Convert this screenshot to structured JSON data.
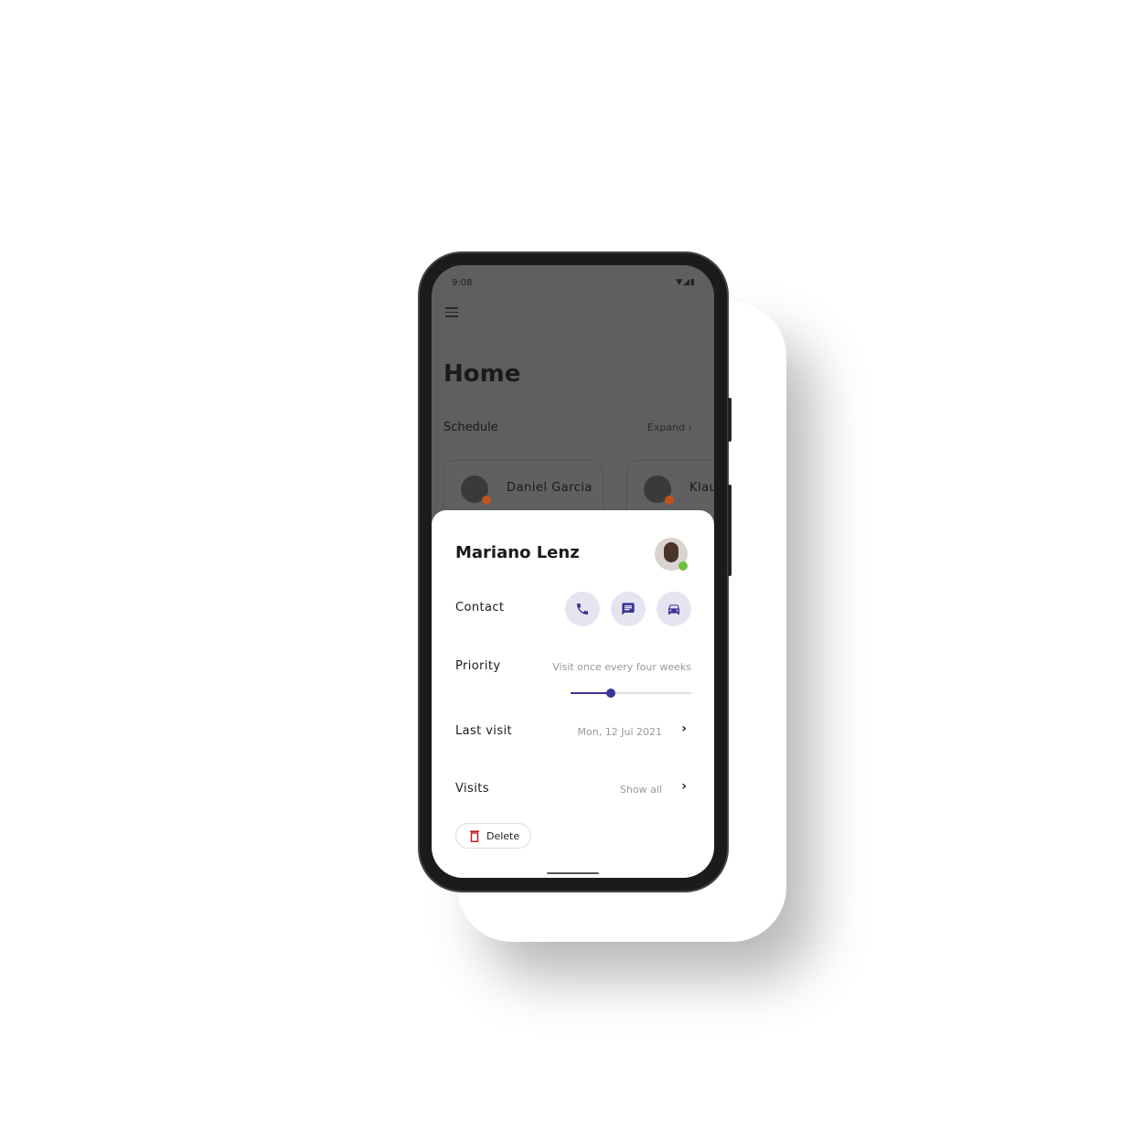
{
  "status_bar": {
    "time": "9:08",
    "icons": [
      "wifi-icon",
      "signal-icon",
      "battery-icon"
    ]
  },
  "home": {
    "title": "Home",
    "schedule_label": "Schedule",
    "expand_label": "Expand",
    "cards": [
      {
        "name": "Daniel Garcia",
        "status_color": "#c0541f"
      },
      {
        "name": "Klaus",
        "status_color": "#c0541f"
      }
    ]
  },
  "sheet": {
    "name": "Mariano Lenz",
    "online_color": "#6dbf3c",
    "contact_label": "Contact",
    "contact_actions": [
      "phone-icon",
      "message-icon",
      "car-icon"
    ],
    "priority_label": "Priority",
    "priority_value": "Visit once every four weeks",
    "priority_slider_fraction": 0.33,
    "last_visit_label": "Last visit",
    "last_visit_value": "Mon, 12 Jul 2021",
    "visits_label": "Visits",
    "visits_value": "Show all",
    "delete_label": "Delete"
  },
  "colors": {
    "accent": "#3b3494",
    "accent_bg": "#e6e4f0",
    "delete": "#c0141b"
  }
}
